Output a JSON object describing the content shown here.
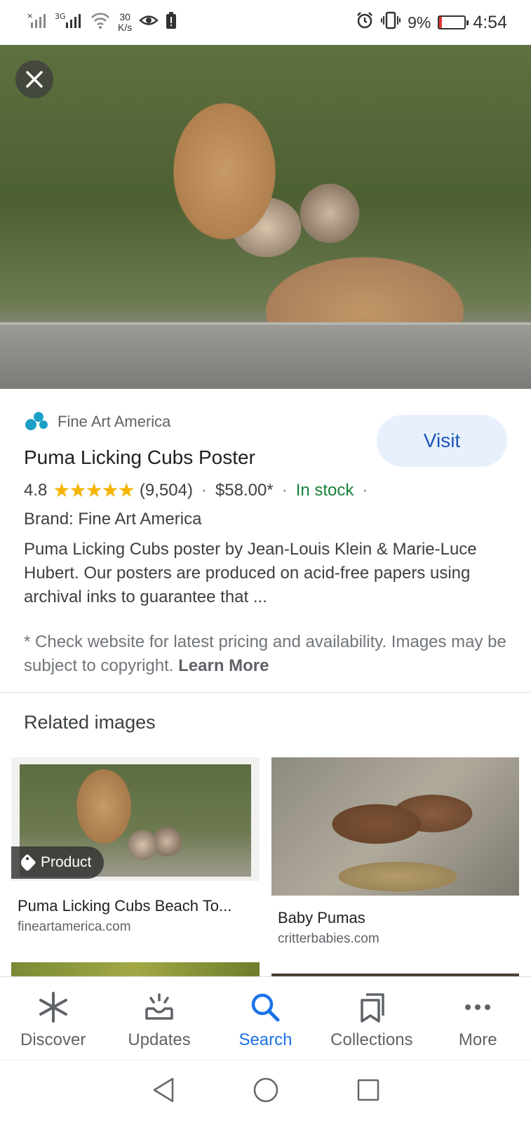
{
  "status_bar": {
    "signal1": "×",
    "signal2": "3G",
    "speed_value": "30",
    "speed_unit": "K/s",
    "battery": "9%",
    "battery_level": 0.09,
    "battery_color": "#e53935",
    "time": "4:54",
    "icons": [
      "signal-icon",
      "wifi-icon",
      "eye-icon",
      "alert-battery-icon",
      "alarm-icon",
      "vibrate-icon",
      "battery-icon"
    ]
  },
  "hero": {
    "close_icon": "close-icon"
  },
  "product": {
    "source": "Fine Art America",
    "visit_label": "Visit",
    "title": "Puma Licking Cubs Poster",
    "rating": "4.8",
    "stars": "★★★★★",
    "reviews": "(9,504)",
    "separator": "·",
    "price": "$58.00*",
    "availability": "In stock",
    "brand": "Brand: Fine Art America",
    "description": "Puma Licking Cubs poster by Jean-Louis Klein & Marie-Luce Hubert. Our posters are produced on acid-free papers using archival inks to guarantee that ...",
    "disclaimer": "* Check website for latest pricing and availability. Images may be subject to copyright.",
    "learn_more": "Learn More"
  },
  "related": {
    "heading": "Related images",
    "items": [
      {
        "title": "Puma Licking Cubs Beach To...",
        "source": "fineartamerica.com",
        "badge": "Product"
      },
      {
        "title": "Baby Pumas",
        "source": "critterbabies.com"
      }
    ]
  },
  "bottom_nav": {
    "items": [
      {
        "label": "Discover",
        "icon": "asterisk-icon"
      },
      {
        "label": "Updates",
        "icon": "updates-icon"
      },
      {
        "label": "Search",
        "icon": "search-icon",
        "active": true
      },
      {
        "label": "Collections",
        "icon": "bookmarks-icon"
      },
      {
        "label": "More",
        "icon": "more-icon"
      }
    ],
    "active_color": "#1a73e8"
  },
  "system_nav": {
    "icons": [
      "back-icon",
      "home-icon",
      "recents-icon"
    ]
  }
}
